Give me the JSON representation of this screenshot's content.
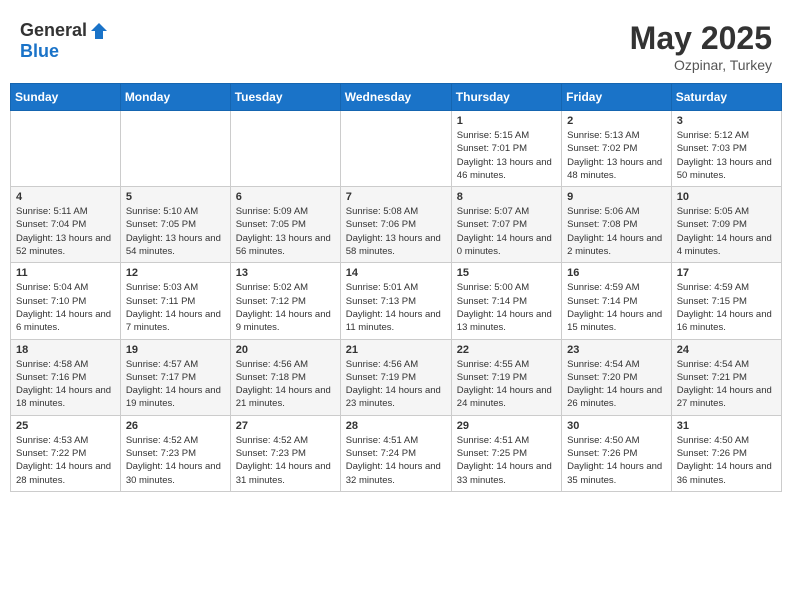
{
  "header": {
    "logo_general": "General",
    "logo_blue": "Blue",
    "title": "May 2025",
    "location": "Ozpinar, Turkey"
  },
  "days_of_week": [
    "Sunday",
    "Monday",
    "Tuesday",
    "Wednesday",
    "Thursday",
    "Friday",
    "Saturday"
  ],
  "weeks": [
    [
      {
        "date": "",
        "sunrise": "",
        "sunset": "",
        "daylight": ""
      },
      {
        "date": "",
        "sunrise": "",
        "sunset": "",
        "daylight": ""
      },
      {
        "date": "",
        "sunrise": "",
        "sunset": "",
        "daylight": ""
      },
      {
        "date": "",
        "sunrise": "",
        "sunset": "",
        "daylight": ""
      },
      {
        "date": "1",
        "sunrise": "Sunrise: 5:15 AM",
        "sunset": "Sunset: 7:01 PM",
        "daylight": "Daylight: 13 hours and 46 minutes."
      },
      {
        "date": "2",
        "sunrise": "Sunrise: 5:13 AM",
        "sunset": "Sunset: 7:02 PM",
        "daylight": "Daylight: 13 hours and 48 minutes."
      },
      {
        "date": "3",
        "sunrise": "Sunrise: 5:12 AM",
        "sunset": "Sunset: 7:03 PM",
        "daylight": "Daylight: 13 hours and 50 minutes."
      }
    ],
    [
      {
        "date": "4",
        "sunrise": "Sunrise: 5:11 AM",
        "sunset": "Sunset: 7:04 PM",
        "daylight": "Daylight: 13 hours and 52 minutes."
      },
      {
        "date": "5",
        "sunrise": "Sunrise: 5:10 AM",
        "sunset": "Sunset: 7:05 PM",
        "daylight": "Daylight: 13 hours and 54 minutes."
      },
      {
        "date": "6",
        "sunrise": "Sunrise: 5:09 AM",
        "sunset": "Sunset: 7:05 PM",
        "daylight": "Daylight: 13 hours and 56 minutes."
      },
      {
        "date": "7",
        "sunrise": "Sunrise: 5:08 AM",
        "sunset": "Sunset: 7:06 PM",
        "daylight": "Daylight: 13 hours and 58 minutes."
      },
      {
        "date": "8",
        "sunrise": "Sunrise: 5:07 AM",
        "sunset": "Sunset: 7:07 PM",
        "daylight": "Daylight: 14 hours and 0 minutes."
      },
      {
        "date": "9",
        "sunrise": "Sunrise: 5:06 AM",
        "sunset": "Sunset: 7:08 PM",
        "daylight": "Daylight: 14 hours and 2 minutes."
      },
      {
        "date": "10",
        "sunrise": "Sunrise: 5:05 AM",
        "sunset": "Sunset: 7:09 PM",
        "daylight": "Daylight: 14 hours and 4 minutes."
      }
    ],
    [
      {
        "date": "11",
        "sunrise": "Sunrise: 5:04 AM",
        "sunset": "Sunset: 7:10 PM",
        "daylight": "Daylight: 14 hours and 6 minutes."
      },
      {
        "date": "12",
        "sunrise": "Sunrise: 5:03 AM",
        "sunset": "Sunset: 7:11 PM",
        "daylight": "Daylight: 14 hours and 7 minutes."
      },
      {
        "date": "13",
        "sunrise": "Sunrise: 5:02 AM",
        "sunset": "Sunset: 7:12 PM",
        "daylight": "Daylight: 14 hours and 9 minutes."
      },
      {
        "date": "14",
        "sunrise": "Sunrise: 5:01 AM",
        "sunset": "Sunset: 7:13 PM",
        "daylight": "Daylight: 14 hours and 11 minutes."
      },
      {
        "date": "15",
        "sunrise": "Sunrise: 5:00 AM",
        "sunset": "Sunset: 7:14 PM",
        "daylight": "Daylight: 14 hours and 13 minutes."
      },
      {
        "date": "16",
        "sunrise": "Sunrise: 4:59 AM",
        "sunset": "Sunset: 7:14 PM",
        "daylight": "Daylight: 14 hours and 15 minutes."
      },
      {
        "date": "17",
        "sunrise": "Sunrise: 4:59 AM",
        "sunset": "Sunset: 7:15 PM",
        "daylight": "Daylight: 14 hours and 16 minutes."
      }
    ],
    [
      {
        "date": "18",
        "sunrise": "Sunrise: 4:58 AM",
        "sunset": "Sunset: 7:16 PM",
        "daylight": "Daylight: 14 hours and 18 minutes."
      },
      {
        "date": "19",
        "sunrise": "Sunrise: 4:57 AM",
        "sunset": "Sunset: 7:17 PM",
        "daylight": "Daylight: 14 hours and 19 minutes."
      },
      {
        "date": "20",
        "sunrise": "Sunrise: 4:56 AM",
        "sunset": "Sunset: 7:18 PM",
        "daylight": "Daylight: 14 hours and 21 minutes."
      },
      {
        "date": "21",
        "sunrise": "Sunrise: 4:56 AM",
        "sunset": "Sunset: 7:19 PM",
        "daylight": "Daylight: 14 hours and 23 minutes."
      },
      {
        "date": "22",
        "sunrise": "Sunrise: 4:55 AM",
        "sunset": "Sunset: 7:19 PM",
        "daylight": "Daylight: 14 hours and 24 minutes."
      },
      {
        "date": "23",
        "sunrise": "Sunrise: 4:54 AM",
        "sunset": "Sunset: 7:20 PM",
        "daylight": "Daylight: 14 hours and 26 minutes."
      },
      {
        "date": "24",
        "sunrise": "Sunrise: 4:54 AM",
        "sunset": "Sunset: 7:21 PM",
        "daylight": "Daylight: 14 hours and 27 minutes."
      }
    ],
    [
      {
        "date": "25",
        "sunrise": "Sunrise: 4:53 AM",
        "sunset": "Sunset: 7:22 PM",
        "daylight": "Daylight: 14 hours and 28 minutes."
      },
      {
        "date": "26",
        "sunrise": "Sunrise: 4:52 AM",
        "sunset": "Sunset: 7:23 PM",
        "daylight": "Daylight: 14 hours and 30 minutes."
      },
      {
        "date": "27",
        "sunrise": "Sunrise: 4:52 AM",
        "sunset": "Sunset: 7:23 PM",
        "daylight": "Daylight: 14 hours and 31 minutes."
      },
      {
        "date": "28",
        "sunrise": "Sunrise: 4:51 AM",
        "sunset": "Sunset: 7:24 PM",
        "daylight": "Daylight: 14 hours and 32 minutes."
      },
      {
        "date": "29",
        "sunrise": "Sunrise: 4:51 AM",
        "sunset": "Sunset: 7:25 PM",
        "daylight": "Daylight: 14 hours and 33 minutes."
      },
      {
        "date": "30",
        "sunrise": "Sunrise: 4:50 AM",
        "sunset": "Sunset: 7:26 PM",
        "daylight": "Daylight: 14 hours and 35 minutes."
      },
      {
        "date": "31",
        "sunrise": "Sunrise: 4:50 AM",
        "sunset": "Sunset: 7:26 PM",
        "daylight": "Daylight: 14 hours and 36 minutes."
      }
    ]
  ]
}
